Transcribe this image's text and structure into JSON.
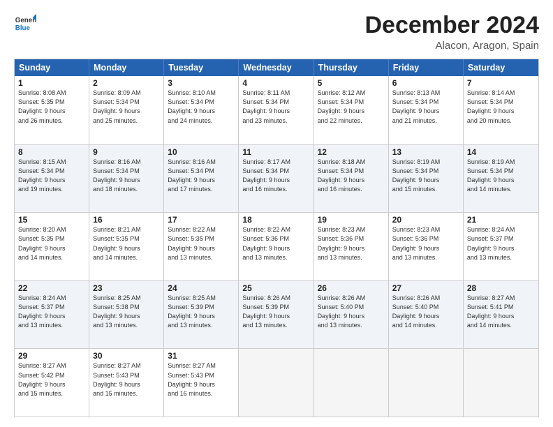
{
  "logo": {
    "line1": "General",
    "line2": "Blue"
  },
  "title": "December 2024",
  "subtitle": "Alacon, Aragon, Spain",
  "header_days": [
    "Sunday",
    "Monday",
    "Tuesday",
    "Wednesday",
    "Thursday",
    "Friday",
    "Saturday"
  ],
  "rows": [
    [
      {
        "day": "1",
        "info": "Sunrise: 8:08 AM\nSunset: 5:35 PM\nDaylight: 9 hours\nand 26 minutes."
      },
      {
        "day": "2",
        "info": "Sunrise: 8:09 AM\nSunset: 5:34 PM\nDaylight: 9 hours\nand 25 minutes."
      },
      {
        "day": "3",
        "info": "Sunrise: 8:10 AM\nSunset: 5:34 PM\nDaylight: 9 hours\nand 24 minutes."
      },
      {
        "day": "4",
        "info": "Sunrise: 8:11 AM\nSunset: 5:34 PM\nDaylight: 9 hours\nand 23 minutes."
      },
      {
        "day": "5",
        "info": "Sunrise: 8:12 AM\nSunset: 5:34 PM\nDaylight: 9 hours\nand 22 minutes."
      },
      {
        "day": "6",
        "info": "Sunrise: 8:13 AM\nSunset: 5:34 PM\nDaylight: 9 hours\nand 21 minutes."
      },
      {
        "day": "7",
        "info": "Sunrise: 8:14 AM\nSunset: 5:34 PM\nDaylight: 9 hours\nand 20 minutes."
      }
    ],
    [
      {
        "day": "8",
        "info": "Sunrise: 8:15 AM\nSunset: 5:34 PM\nDaylight: 9 hours\nand 19 minutes."
      },
      {
        "day": "9",
        "info": "Sunrise: 8:16 AM\nSunset: 5:34 PM\nDaylight: 9 hours\nand 18 minutes."
      },
      {
        "day": "10",
        "info": "Sunrise: 8:16 AM\nSunset: 5:34 PM\nDaylight: 9 hours\nand 17 minutes."
      },
      {
        "day": "11",
        "info": "Sunrise: 8:17 AM\nSunset: 5:34 PM\nDaylight: 9 hours\nand 16 minutes."
      },
      {
        "day": "12",
        "info": "Sunrise: 8:18 AM\nSunset: 5:34 PM\nDaylight: 9 hours\nand 16 minutes."
      },
      {
        "day": "13",
        "info": "Sunrise: 8:19 AM\nSunset: 5:34 PM\nDaylight: 9 hours\nand 15 minutes."
      },
      {
        "day": "14",
        "info": "Sunrise: 8:19 AM\nSunset: 5:34 PM\nDaylight: 9 hours\nand 14 minutes."
      }
    ],
    [
      {
        "day": "15",
        "info": "Sunrise: 8:20 AM\nSunset: 5:35 PM\nDaylight: 9 hours\nand 14 minutes."
      },
      {
        "day": "16",
        "info": "Sunrise: 8:21 AM\nSunset: 5:35 PM\nDaylight: 9 hours\nand 14 minutes."
      },
      {
        "day": "17",
        "info": "Sunrise: 8:22 AM\nSunset: 5:35 PM\nDaylight: 9 hours\nand 13 minutes."
      },
      {
        "day": "18",
        "info": "Sunrise: 8:22 AM\nSunset: 5:36 PM\nDaylight: 9 hours\nand 13 minutes."
      },
      {
        "day": "19",
        "info": "Sunrise: 8:23 AM\nSunset: 5:36 PM\nDaylight: 9 hours\nand 13 minutes."
      },
      {
        "day": "20",
        "info": "Sunrise: 8:23 AM\nSunset: 5:36 PM\nDaylight: 9 hours\nand 13 minutes."
      },
      {
        "day": "21",
        "info": "Sunrise: 8:24 AM\nSunset: 5:37 PM\nDaylight: 9 hours\nand 13 minutes."
      }
    ],
    [
      {
        "day": "22",
        "info": "Sunrise: 8:24 AM\nSunset: 5:37 PM\nDaylight: 9 hours\nand 13 minutes."
      },
      {
        "day": "23",
        "info": "Sunrise: 8:25 AM\nSunset: 5:38 PM\nDaylight: 9 hours\nand 13 minutes."
      },
      {
        "day": "24",
        "info": "Sunrise: 8:25 AM\nSunset: 5:39 PM\nDaylight: 9 hours\nand 13 minutes."
      },
      {
        "day": "25",
        "info": "Sunrise: 8:26 AM\nSunset: 5:39 PM\nDaylight: 9 hours\nand 13 minutes."
      },
      {
        "day": "26",
        "info": "Sunrise: 8:26 AM\nSunset: 5:40 PM\nDaylight: 9 hours\nand 13 minutes."
      },
      {
        "day": "27",
        "info": "Sunrise: 8:26 AM\nSunset: 5:40 PM\nDaylight: 9 hours\nand 14 minutes."
      },
      {
        "day": "28",
        "info": "Sunrise: 8:27 AM\nSunset: 5:41 PM\nDaylight: 9 hours\nand 14 minutes."
      }
    ],
    [
      {
        "day": "29",
        "info": "Sunrise: 8:27 AM\nSunset: 5:42 PM\nDaylight: 9 hours\nand 15 minutes."
      },
      {
        "day": "30",
        "info": "Sunrise: 8:27 AM\nSunset: 5:43 PM\nDaylight: 9 hours\nand 15 minutes."
      },
      {
        "day": "31",
        "info": "Sunrise: 8:27 AM\nSunset: 5:43 PM\nDaylight: 9 hours\nand 16 minutes."
      },
      {
        "day": "",
        "info": ""
      },
      {
        "day": "",
        "info": ""
      },
      {
        "day": "",
        "info": ""
      },
      {
        "day": "",
        "info": ""
      }
    ]
  ],
  "alt_rows": [
    1,
    3
  ]
}
